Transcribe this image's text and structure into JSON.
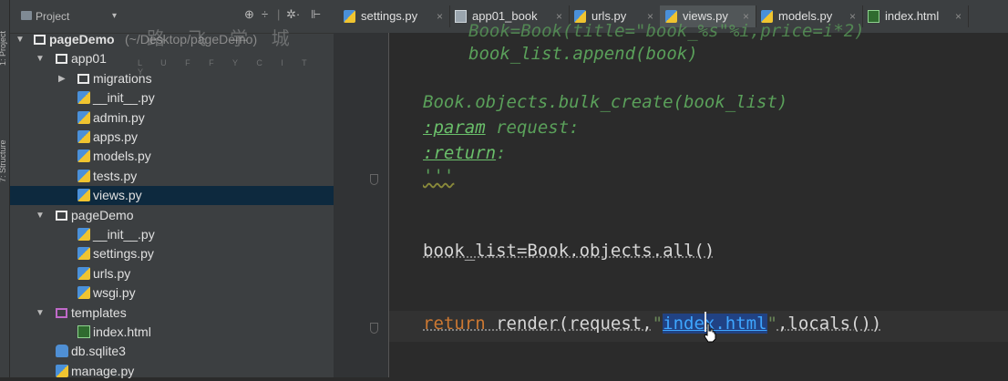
{
  "toolstrip": {
    "project_tab": "1: Project",
    "structure_tab": "7: Structure"
  },
  "project_panel": {
    "header_label": "Project",
    "dropdown_glyph": "▾",
    "header_buttons": [
      "⊕",
      "÷",
      "|",
      "✲·",
      "⊩"
    ],
    "watermark_title": "路 飞 学 城",
    "watermark_sub": "L U F F Y C I T Y",
    "tree": [
      {
        "label": "pageDemo",
        "suffix": "(~/Desktop/pageDemo)",
        "type": "folder",
        "depth": 0,
        "expanded": true
      },
      {
        "label": "app01",
        "type": "folder",
        "depth": 1,
        "expanded": true
      },
      {
        "label": "migrations",
        "type": "folder",
        "depth": 2,
        "expanded": false
      },
      {
        "label": "__init__.py",
        "type": "py",
        "depth": 3
      },
      {
        "label": "admin.py",
        "type": "py",
        "depth": 3
      },
      {
        "label": "apps.py",
        "type": "py",
        "depth": 3
      },
      {
        "label": "models.py",
        "type": "py",
        "depth": 3
      },
      {
        "label": "tests.py",
        "type": "py",
        "depth": 3
      },
      {
        "label": "views.py",
        "type": "py",
        "depth": 3,
        "selected": true
      },
      {
        "label": "pageDemo",
        "type": "folder",
        "depth": 1,
        "expanded": true
      },
      {
        "label": "__init__.py",
        "type": "py",
        "depth": 3
      },
      {
        "label": "settings.py",
        "type": "py",
        "depth": 3
      },
      {
        "label": "urls.py",
        "type": "py",
        "depth": 3
      },
      {
        "label": "wsgi.py",
        "type": "py",
        "depth": 3
      },
      {
        "label": "templates",
        "type": "folder-magenta",
        "depth": 1,
        "expanded": true
      },
      {
        "label": "index.html",
        "type": "html",
        "depth": 3
      },
      {
        "label": "db.sqlite3",
        "type": "db",
        "depth": 2
      },
      {
        "label": "manage.py",
        "type": "py",
        "depth": 2
      }
    ]
  },
  "tabs": [
    {
      "label": "settings.py",
      "icon": "python-file-icon",
      "active": false
    },
    {
      "label": "app01_book",
      "icon": "table-icon",
      "active": false
    },
    {
      "label": "urls.py",
      "icon": "python-file-icon",
      "active": false
    },
    {
      "label": "views.py",
      "icon": "python-file-icon",
      "active": true
    },
    {
      "label": "models.py",
      "icon": "python-file-icon",
      "active": false
    },
    {
      "label": "index.html",
      "icon": "html-file-icon",
      "active": false
    }
  ],
  "tab_close_glyph": "×",
  "editor": {
    "line0": "Book=Book(title=\"book_%s\"%i,price=i*2)",
    "line1": "book_list.append(book)",
    "line2": "Book.objects.bulk_create(book_list)",
    "line3_tag": ":param",
    "line3_rest": " request:",
    "line4_tag": ":return",
    "line4_rest": ":",
    "line5": "'''",
    "line6": "book_list=Book.objects.all()",
    "line7_kw": "return",
    "line7_a": " render(request,",
    "line7_q1": "\"",
    "line7_str": "index.html",
    "line7_q2": "\"",
    "line7_b": ",locals())"
  },
  "colors": {
    "keyword": "#cc7832",
    "docstring": "#5aa05a",
    "selection": "#0d293e",
    "string_link": "#3ea6ff"
  }
}
